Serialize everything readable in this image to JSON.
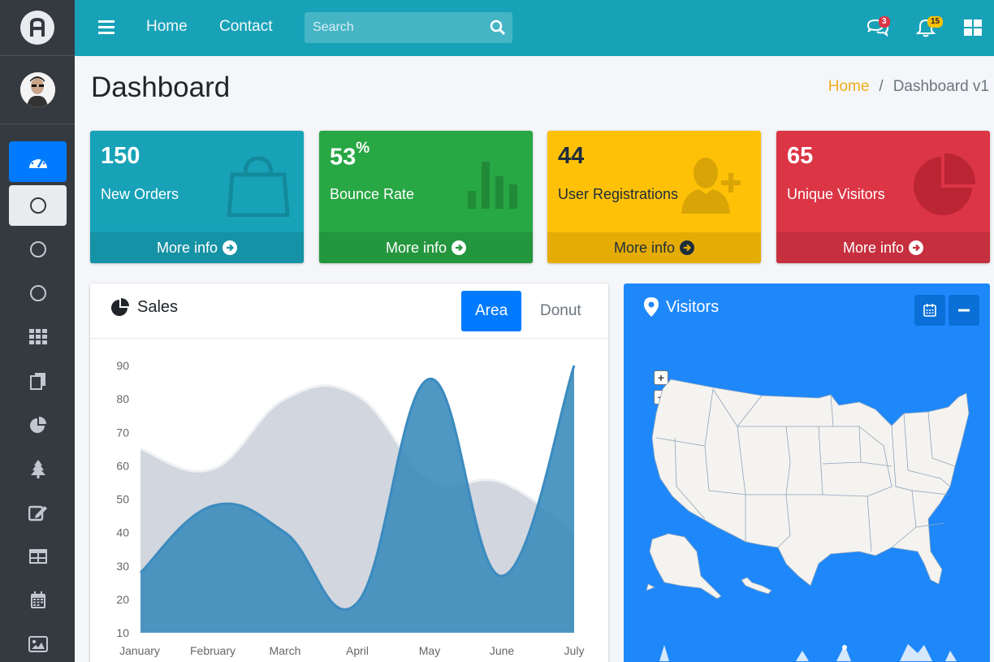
{
  "topbar": {
    "nav_links": [
      "Home",
      "Contact"
    ],
    "search_placeholder": "Search",
    "messages_count": "3",
    "notifications_count": "15"
  },
  "header": {
    "title": "Dashboard",
    "breadcrumb": [
      "Home",
      "Dashboard v1"
    ],
    "breadcrumb_sep": "/"
  },
  "sidebar": {
    "items": [
      {
        "icon": "dashboard-icon",
        "state": "active"
      },
      {
        "icon": "circle-icon",
        "state": "open"
      },
      {
        "icon": "circle-icon"
      },
      {
        "icon": "circle-icon"
      },
      {
        "icon": "grid-icon"
      },
      {
        "icon": "copy-icon"
      },
      {
        "icon": "pie-chart-icon"
      },
      {
        "icon": "tree-icon"
      },
      {
        "icon": "edit-icon"
      },
      {
        "icon": "table-icon"
      },
      {
        "icon": "calendar-icon"
      },
      {
        "icon": "image-icon"
      }
    ]
  },
  "stats": [
    {
      "value": "150",
      "suffix": "",
      "label": "New Orders",
      "link": "More info",
      "color": "#17a2b8",
      "icon": "shopping-bag-icon"
    },
    {
      "value": "53",
      "suffix": "%",
      "label": "Bounce Rate",
      "link": "More info",
      "color": "#28a745",
      "icon": "bar-chart-icon"
    },
    {
      "value": "44",
      "suffix": "",
      "label": "User Registrations",
      "link": "More info",
      "color": "#ffc107",
      "icon": "user-plus-icon"
    },
    {
      "value": "65",
      "suffix": "",
      "label": "Unique Visitors",
      "link": "More info",
      "color": "#dc3545",
      "icon": "pie-chart-icon"
    }
  ],
  "sales": {
    "title": "Sales",
    "tabs": [
      "Area",
      "Donut"
    ],
    "active_tab": "Area"
  },
  "visitors": {
    "title": "Visitors",
    "zoom_in": "+",
    "zoom_out": "−"
  },
  "chart_data": {
    "type": "area",
    "categories": [
      "January",
      "February",
      "March",
      "April",
      "May",
      "June",
      "July"
    ],
    "ylim": [
      10,
      90
    ],
    "yticks": [
      10,
      20,
      30,
      40,
      50,
      60,
      70,
      80,
      90
    ],
    "grid": false,
    "series": [
      {
        "values": [
          65,
          59,
          80,
          81,
          56,
          55,
          40
        ],
        "color": "#d2d6de"
      },
      {
        "values": [
          28,
          48,
          40,
          19,
          86,
          27,
          90
        ],
        "color": "#3c8dbc"
      }
    ]
  }
}
